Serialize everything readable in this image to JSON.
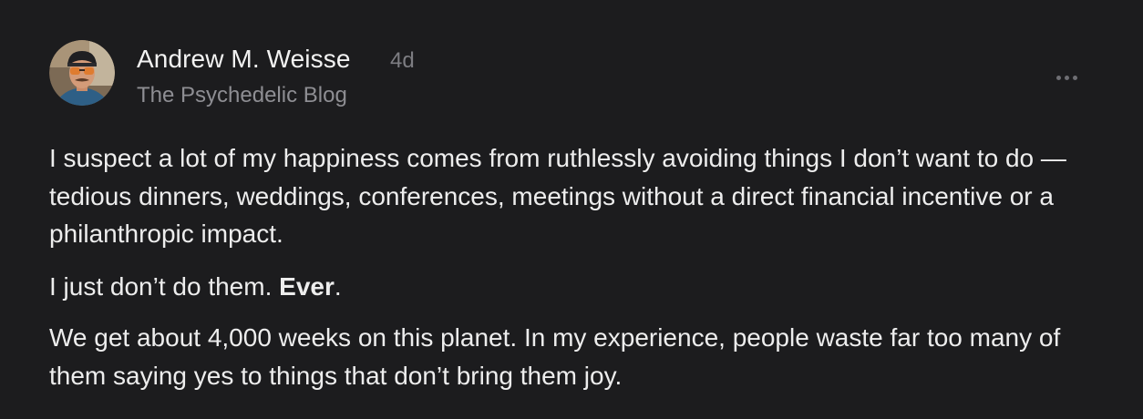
{
  "author": {
    "name": "Andrew M. Weisse",
    "timestamp": "4d",
    "publication": "The Psychedelic Blog",
    "avatar_icon": "profile-photo"
  },
  "menu": {
    "icon": "more-horizontal-icon"
  },
  "post": {
    "paragraph1": "I suspect a lot of my happiness comes from ruthlessly avoiding things I don’t want to do — tedious dinners, weddings, conferences, meetings without a direct financial incentive or a philanthropic impact.",
    "paragraph2_start": "I just don’t do them. ",
    "paragraph2_bold": "Ever",
    "paragraph2_end": ".",
    "paragraph3": "We get about 4,000 weeks on this planet. In my experience, people waste far too many of them saying yes to things that don’t bring them joy."
  },
  "colors": {
    "background": "#1c1c1e",
    "text": "#ededed",
    "secondary": "#8e8e93"
  }
}
